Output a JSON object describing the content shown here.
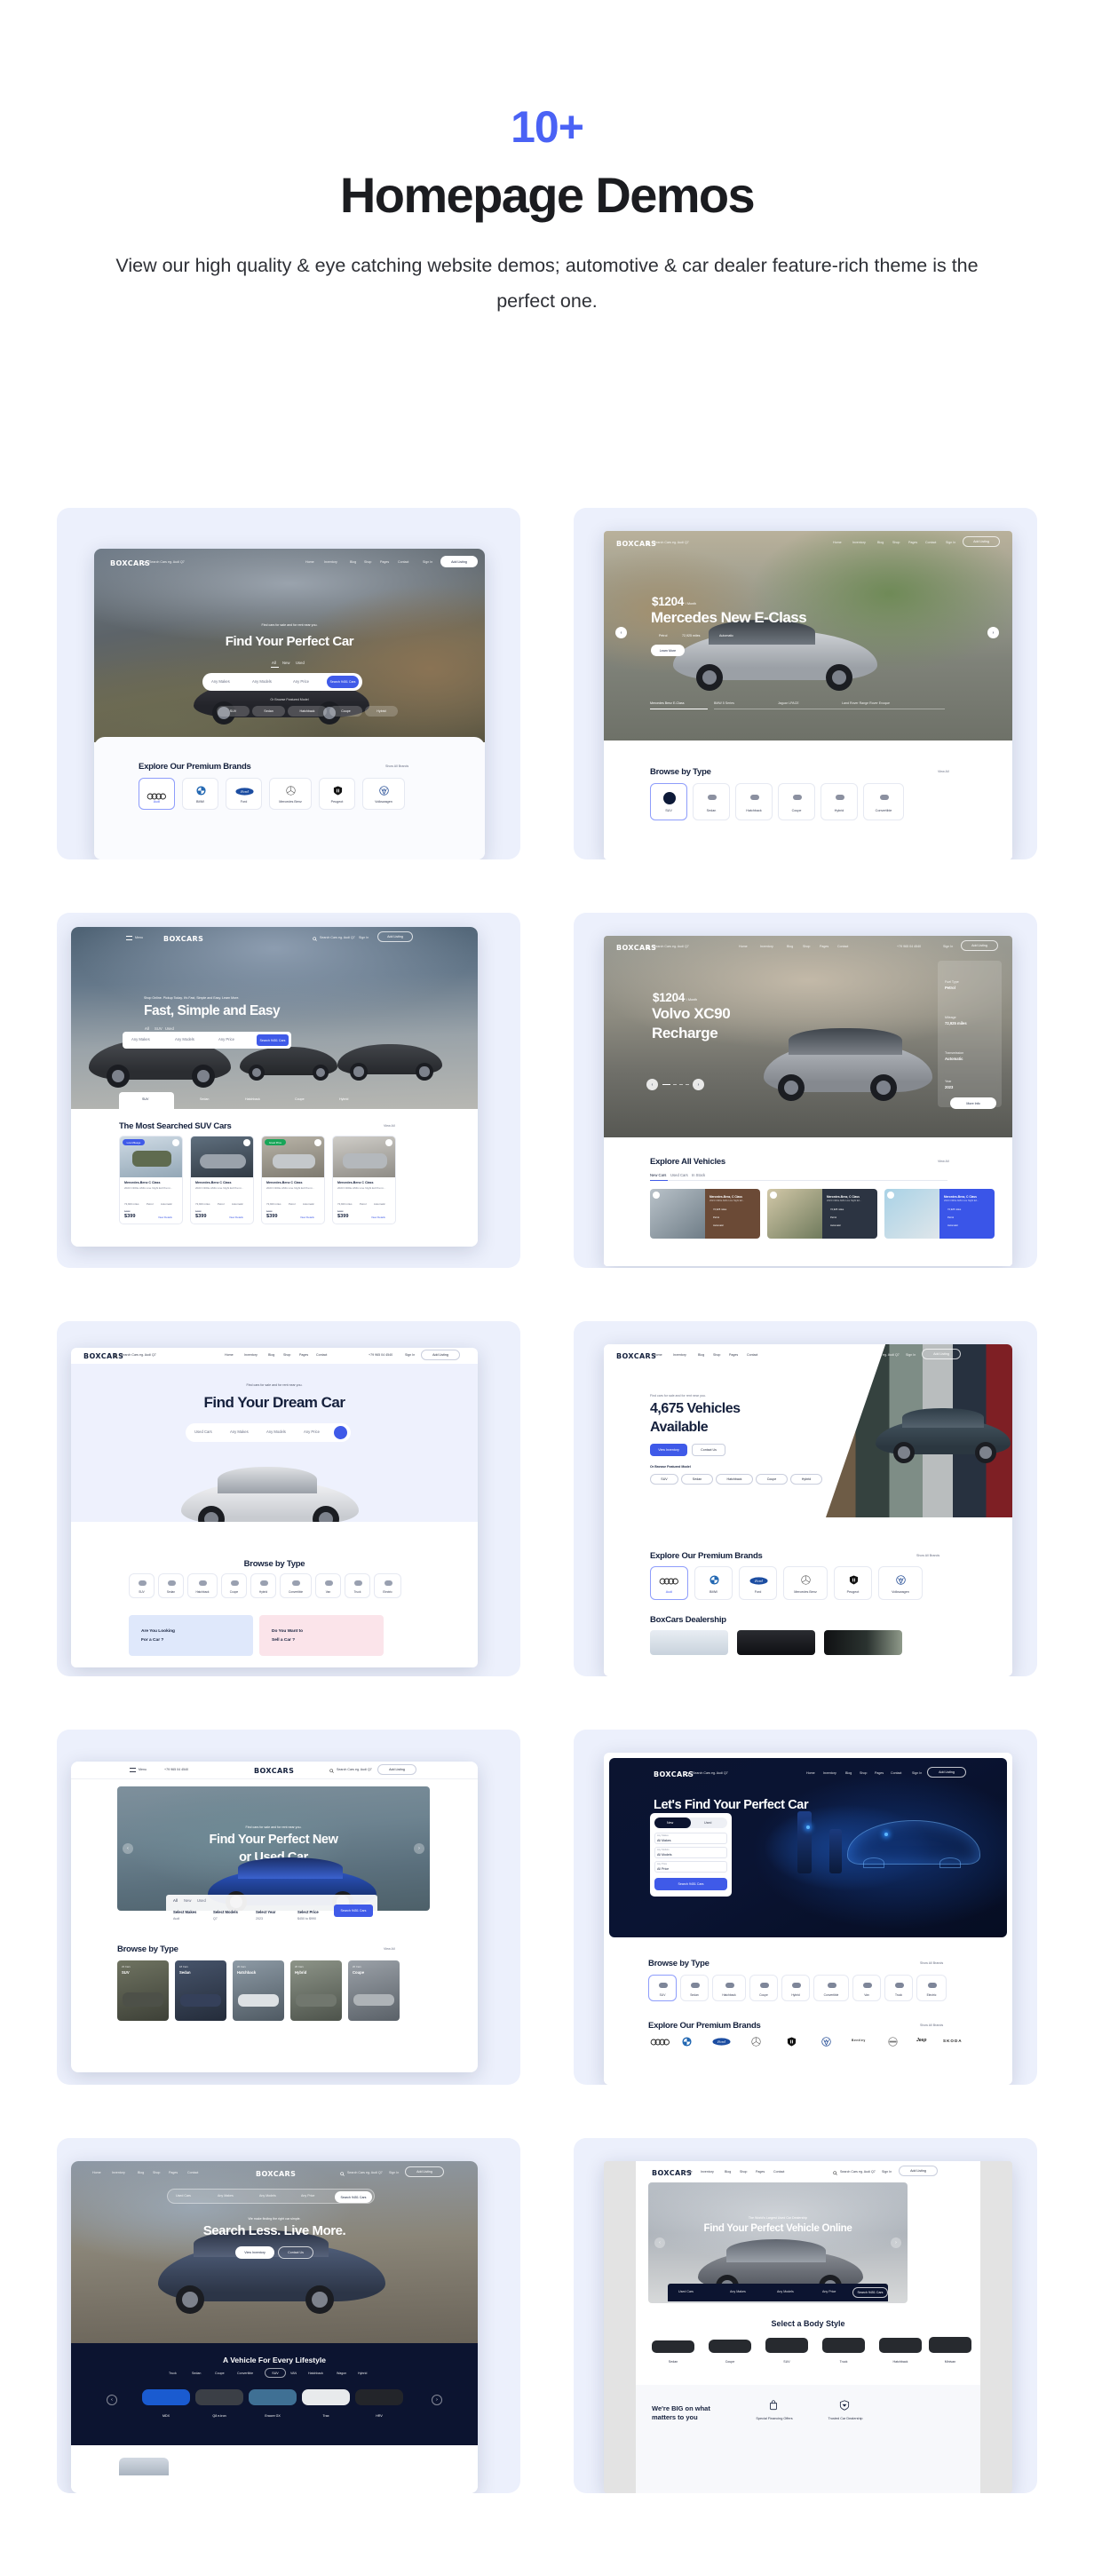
{
  "header": {
    "eyebrow": "10+",
    "title": "Homepage Demos",
    "subtitle": "View our high quality & eye catching website demos; automotive & car dealer feature-rich theme is the perfect one."
  },
  "brand": {
    "name": "BOXCARS"
  },
  "common": {
    "nav": [
      "Home",
      "Inventory",
      "Blog",
      "Shop",
      "Pages",
      "Contact"
    ],
    "search_placeholder": "Search Cars eg. Audi Q7",
    "sign_in": "Sign In",
    "add_listing": "Add Listing",
    "menu": "Menu",
    "phone": "+79 965 04 4540",
    "view_all": "View All",
    "show_all_brands": "Show All Brands",
    "view_details": "View Details",
    "learn_more": "Learn More",
    "more_info": "More Info",
    "view_inventory": "View Inventory",
    "contact_us": "Contact Us",
    "makes": "Any Makes",
    "models": "Any Models",
    "price": "Any Price",
    "search_cta": "Search 9451 Cars",
    "browse_featured": "Or Browse Featured Model"
  },
  "brands": [
    {
      "name": "Audi",
      "logo": "audi-logo"
    },
    {
      "name": "BMW",
      "logo": "bmw-logo"
    },
    {
      "name": "Ford",
      "logo": "ford-logo"
    },
    {
      "name": "Mercedes Benz",
      "logo": "mercedes-logo"
    },
    {
      "name": "Peugeot",
      "logo": "peugeot-logo"
    },
    {
      "name": "Volkswagen",
      "logo": "volkswagen-logo"
    }
  ],
  "body_types_6": [
    "SUV",
    "Sedan",
    "Hatchback",
    "Coupe",
    "Hybrid",
    "Convertible"
  ],
  "body_types_9": [
    "SUV",
    "Sedan",
    "Hatchback",
    "Coupe",
    "Hybrid",
    "Convertible",
    "Van",
    "Truck",
    "Electric"
  ],
  "body_types_5": [
    "SUV",
    "Sedan",
    "Hatchback",
    "Coupe",
    "Hybrid"
  ],
  "demos": [
    {
      "id": "demo-1",
      "tabs": [
        "All",
        "New",
        "Used"
      ],
      "eyebrow": "Find cars for sale and for rent near you.",
      "headline": "Find Your Perfect Car",
      "section_title": "Explore Our Premium Brands",
      "section_link": "Show All Brands"
    },
    {
      "id": "demo-2",
      "price": "$1204",
      "price_unit": "/ Month",
      "headline": "Mercedes New E-Class",
      "specs": [
        "Petrol",
        "72,925 miles",
        "Automatic"
      ],
      "cta": "Learn More",
      "thumbs": [
        "Mercedes Benz E-Class",
        "BMW 5 Series",
        "Jaguar I-PACE",
        "Land Rover Range Rover Evoque"
      ],
      "section_title": "Browse by Type",
      "section_link": "View All"
    },
    {
      "id": "demo-3",
      "eyebrow": "Shop Online. Pickup Today. It's Fast, Simple and Easy. Learn More.",
      "headline": "Fast, Simple and Easy",
      "tabs": [
        "All",
        "SUV",
        "Used"
      ],
      "section_title": "The Most Searched SUV Cars",
      "section_link": "View All",
      "cars": [
        {
          "badge": "Low Mileage",
          "title": "Mercedes-Benz C Class",
          "desc": "2023 C300e AMG Line Night Ed Premi...",
          "miles": "72,923 miles",
          "fuel": "Petrol",
          "trans": "Automatic",
          "old_price": "$780",
          "price": "$399"
        },
        {
          "badge": "",
          "title": "Mercedes-Benz C Class",
          "desc": "2023 C300e AMG Line Night Ed Premi...",
          "miles": "72,923 miles",
          "fuel": "Petrol",
          "trans": "Automatic",
          "old_price": "$780",
          "price": "$399"
        },
        {
          "badge": "Great Price",
          "title": "Mercedes-Benz C Class",
          "desc": "2023 C300e AMG Line Night Ed Premi...",
          "miles": "72,923 miles",
          "fuel": "Petrol",
          "trans": "Automatic",
          "old_price": "$780",
          "price": "$399"
        },
        {
          "badge": "",
          "title": "Mercedes-Benz C Class",
          "desc": "2023 C300e AMG Line Night Ed Premi...",
          "miles": "72,923 miles",
          "fuel": "Petrol",
          "trans": "Automatic",
          "old_price": "$780",
          "price": "$399"
        }
      ]
    },
    {
      "id": "demo-4",
      "price": "$1204",
      "price_unit": "/ Month",
      "headline_1": "Volvo XC90",
      "headline_2": "Recharge",
      "spec_panel": [
        {
          "label": "Fuel Type",
          "value": "Petrol"
        },
        {
          "label": "Mileage",
          "value": "72,925 miles"
        },
        {
          "label": "Transmission",
          "value": "Automatic"
        },
        {
          "label": "Year",
          "value": "2023"
        }
      ],
      "cta": "More Info",
      "section_title": "Explore All Vehicles",
      "section_link": "View All",
      "tabs": [
        "New Cars",
        "Used Cars",
        "In Stock"
      ],
      "cards": [
        {
          "title": "Mercedes-Benz, C Class",
          "desc": "2023 C300e AMG Line Night Ed...",
          "miles": "72,925 miles",
          "fuel": "Petrol",
          "trans": "Automatic",
          "color": "#6b4a36"
        },
        {
          "title": "Mercedes-Benz, C Class",
          "desc": "2023 C300e AMG Line Night Ed...",
          "miles": "72,925 miles",
          "fuel": "Petrol",
          "trans": "Automatic",
          "color": "#2c3442"
        },
        {
          "title": "Mercedes-Benz, C Class",
          "desc": "2023 C300e AMG Line Night Ed...",
          "miles": "72,925 miles",
          "fuel": "Petrol",
          "trans": "Automatic",
          "color": "#3a55e8"
        }
      ]
    },
    {
      "id": "demo-5",
      "eyebrow": "Find cars for sale and for rent near you.",
      "headline": "Find Your Dream Car",
      "filters": [
        "Used Cars",
        "Any Makes",
        "Any Models",
        "Any Price"
      ],
      "section_title": "Browse by Type",
      "promo_left_1": "Are You Looking",
      "promo_left_2": "For a Car ?",
      "promo_right_1": "Do You Want to",
      "promo_right_2": "Sell a Car ?"
    },
    {
      "id": "demo-6",
      "eyebrow": "Find cars for sale and for rent near you.",
      "headline_1": "4,675 Vehicles",
      "headline_2": "Available",
      "cta_primary": "View Inventory",
      "cta_secondary": "Contact Us",
      "featured_label": "Or Browse Featured Model",
      "section_title": "Explore Our Premium Brands",
      "section_link": "Show All Brands",
      "section_title_2": "BoxCars Dealership"
    },
    {
      "id": "demo-7",
      "eyebrow": "Find cars for sale and for rent near you.",
      "headline_1": "Find Your Perfect New",
      "headline_2": "or Used Car",
      "tabs": [
        "All",
        "New",
        "Used"
      ],
      "filters": [
        {
          "label": "Select Makes",
          "value": "Audi"
        },
        {
          "label": "Select Models",
          "value": "Q7"
        },
        {
          "label": "Select Year",
          "value": "2023"
        },
        {
          "label": "Select Price",
          "value": "$450 to $990"
        }
      ],
      "cta": "Search 9451 Cars",
      "section_title": "Browse by Type",
      "section_link": "View All",
      "types": [
        {
          "count": "23 Cars",
          "name": "SUV"
        },
        {
          "count": "18 Cars",
          "name": "Sedan"
        },
        {
          "count": "20 Cars",
          "name": "Hatchback"
        },
        {
          "count": "20 Cars",
          "name": "Hybrid"
        },
        {
          "count": "20 Cars",
          "name": "Coupe"
        }
      ]
    },
    {
      "id": "demo-8",
      "headline": "Let's Find Your Perfect Car",
      "toggle": [
        "New",
        "Used"
      ],
      "fields": [
        {
          "label": "Any Makes",
          "value": "All Makes"
        },
        {
          "label": "Any Models",
          "value": "All Models"
        },
        {
          "label": "Any Price",
          "value": "All Price"
        }
      ],
      "cta": "Search 9451 Cars",
      "section_title": "Browse by Type",
      "section_link": "Show All Brands",
      "section_title_2": "Explore Our Premium Brands",
      "section_link_2": "Show All Brands",
      "brands_row": [
        "Audi",
        "BMW",
        "Ford",
        "Mercedes Benz",
        "Peugeot",
        "Volkswagen",
        "Bentley",
        "Nissan",
        "Jeep",
        "SKODA"
      ]
    },
    {
      "id": "demo-9",
      "filters": [
        "Used Cars",
        "Any Makes",
        "Any Models",
        "Any Price"
      ],
      "cta": "Search 9451 Cars",
      "eyebrow": "We make finding the right car simple.",
      "headline": "Search Less. Live More.",
      "cta_primary": "View Inventory",
      "cta_secondary": "Contact Us",
      "section_title": "A Vehicle For Every Lifestyle",
      "type_tabs": [
        "Truck",
        "Sedan",
        "Coupe",
        "Convertible",
        "SUV",
        "VAN",
        "Hatchback",
        "Wagon",
        "Hybrid"
      ],
      "active_tab": "SUV",
      "models": [
        "MDX",
        "Q8 e-tron",
        "Encore GX",
        "Trax",
        "HRV"
      ]
    },
    {
      "id": "demo-10",
      "eyebrow": "The World's Largest Used Car Dealership",
      "headline": "Find Your Perfect Vehicle Online",
      "filters": [
        "Used Cars",
        "Any Makes",
        "Any Models",
        "Any Price"
      ],
      "cta": "Search 9451 Cars",
      "section_title": "Select a Body Style",
      "styles": [
        "Sedan",
        "Coupe",
        "SUV",
        "Truck",
        "Hatchback",
        "Minivan"
      ],
      "section_title_2a": "We're BIG on what",
      "section_title_2b": "matters to you",
      "features": [
        "Special Financing Offers",
        "Trusted Car Dealership"
      ]
    }
  ]
}
